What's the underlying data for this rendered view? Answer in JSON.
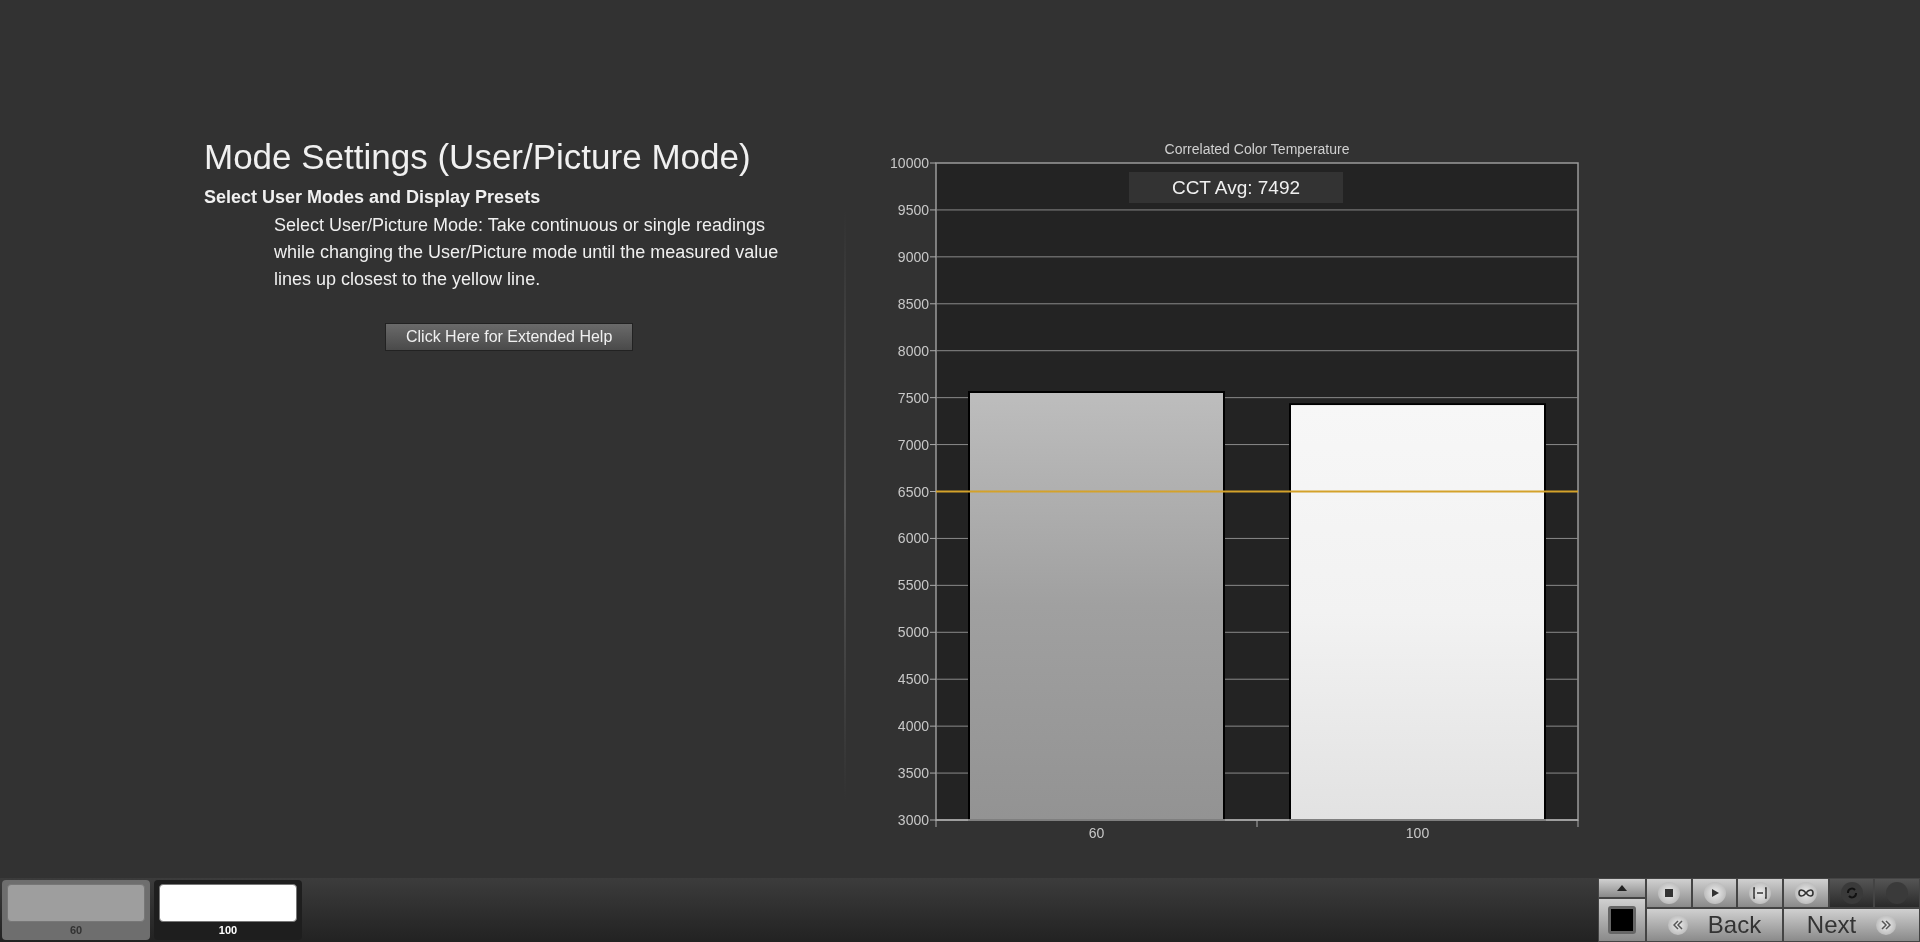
{
  "page": {
    "title": "Mode Settings (User/Picture Mode)",
    "subtitle": "Select User Modes and Display Presets",
    "description": "Select User/Picture Mode: Take continuous or single readings while changing the User/Picture mode until the measured value lines up closest to the yellow line.",
    "help_button": "Click Here for Extended Help"
  },
  "chart": {
    "average_label": "CCT Avg: 7492",
    "chart_data": {
      "type": "bar",
      "title": "Correlated Color Temperature",
      "categories": [
        "60",
        "100"
      ],
      "series": [
        {
          "color": "#a0a0a0",
          "values": [
            7560,
            null
          ]
        },
        {
          "color": "#f2f2f2",
          "values": [
            null,
            7430
          ]
        }
      ],
      "grid": true,
      "ylim": [
        3000,
        10000
      ],
      "yticks": [
        3000,
        3500,
        4000,
        4500,
        5000,
        5500,
        6000,
        6500,
        7000,
        7500,
        8000,
        8500,
        9000,
        9500,
        10000
      ],
      "ref_lines": [
        {
          "axis": "y",
          "value": 6500,
          "color": "#d4a22a"
        }
      ]
    }
  },
  "swatches": [
    {
      "label": "60",
      "color": "#9e9e9e",
      "selected": false
    },
    {
      "label": "100",
      "color": "#ffffff",
      "selected": true
    }
  ],
  "toolbar": {
    "buttons": [
      {
        "kind": "stop",
        "disabled": false
      },
      {
        "kind": "play",
        "disabled": false
      },
      {
        "kind": "range",
        "disabled": false
      },
      {
        "kind": "loop",
        "disabled": false
      },
      {
        "kind": "refresh",
        "disabled": true
      },
      {
        "kind": "blank",
        "disabled": true
      }
    ],
    "back": "Back",
    "next": "Next"
  }
}
